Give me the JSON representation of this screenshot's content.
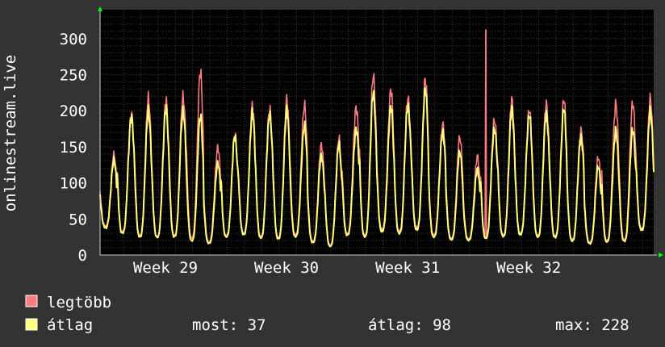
{
  "colors": {
    "background": "#333333",
    "plot_background": "#000000",
    "grid_minor": "#3a3a3a",
    "grid_major": "#5a2a2a",
    "axis": "#cccccc",
    "arrow": "#00ff00",
    "text": "#ffffff"
  },
  "chart_data": {
    "type": "line",
    "ylabel": "onlinestream.live",
    "ylim": [
      0,
      340
    ],
    "yticks": [
      0,
      50,
      100,
      150,
      200,
      250,
      300
    ],
    "x_tick_labels": [
      "Week 29",
      "Week 30",
      "Week 31",
      "Week 32"
    ],
    "grid": true,
    "legend_placement": "bottom-left",
    "days": 32,
    "series": [
      {
        "name": "legtöbb",
        "color": "#ff7b82",
        "daily_peaks": [
          135,
          198,
          218,
          211,
          226,
          248,
          150,
          168,
          202,
          208,
          212,
          208,
          155,
          158,
          210,
          245,
          228,
          222,
          238,
          185,
          162,
          135,
          192,
          210,
          205,
          210,
          212,
          178,
          132,
          212,
          212,
          212
        ],
        "daily_troughs": [
          40,
          32,
          28,
          25,
          28,
          24,
          18,
          28,
          30,
          26,
          25,
          28,
          20,
          14,
          30,
          28,
          35,
          34,
          38,
          28,
          24,
          22,
          26,
          28,
          30,
          28,
          26,
          22,
          18,
          20,
          22,
          36
        ],
        "spike": {
          "day": 22.3,
          "value": 312
        }
      },
      {
        "name": "átlag",
        "color": "#ffff7b",
        "daily_peaks": [
          128,
          195,
          200,
          200,
          205,
          188,
          128,
          165,
          193,
          200,
          198,
          180,
          140,
          150,
          180,
          222,
          205,
          212,
          225,
          175,
          142,
          118,
          180,
          198,
          198,
          196,
          200,
          168,
          120,
          175,
          175,
          195
        ],
        "daily_troughs": [
          38,
          30,
          26,
          24,
          26,
          20,
          16,
          26,
          28,
          24,
          23,
          25,
          18,
          12,
          28,
          26,
          32,
          31,
          35,
          25,
          22,
          20,
          24,
          26,
          28,
          26,
          24,
          20,
          16,
          18,
          20,
          34
        ]
      }
    ]
  },
  "legend": {
    "items": [
      {
        "label": "legtöbb",
        "color": "#ff7b82"
      },
      {
        "label": "átlag",
        "color": "#ffff7b"
      }
    ],
    "stats": {
      "most": "most: 37",
      "atlag": "átlag: 98",
      "max": "max: 228"
    }
  }
}
